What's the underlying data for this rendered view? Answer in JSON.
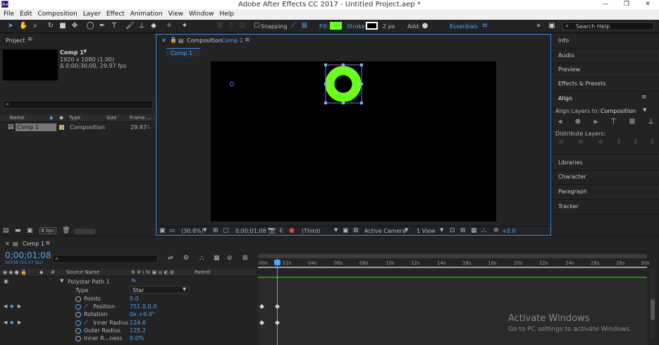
{
  "window": {
    "title": "Adobe After Effects CC 2017 - Untitled Project.aep *",
    "logo": "Ae"
  },
  "menu": [
    "File",
    "Edit",
    "Composition",
    "Layer",
    "Effect",
    "Animation",
    "View",
    "Window",
    "Help"
  ],
  "toolbar": {
    "snapping": "Snapping",
    "fill_label": "Fill:",
    "stroke_label": "Stroke:",
    "stroke_width": "2 px",
    "add_label": "Add:",
    "workspace": "Essentials",
    "search_placeholder": "Search Help",
    "fill_color": "#6bff1a"
  },
  "project": {
    "tab": "Project",
    "comp_name": "Comp 1",
    "comp_res": "1920 x 1080 (1.00)",
    "comp_dur": "Δ 0;00;30;00, 29.97 fps",
    "search_placeholder": "",
    "columns": [
      "Name",
      "Type",
      "Size",
      "Frame ..."
    ],
    "item": {
      "name": "Comp 1",
      "type": "Composition",
      "fps": "29.97"
    },
    "bpc": "8 bpc"
  },
  "composition": {
    "tab_prefix": "Composition",
    "tab_name": "Comp 1",
    "sub_tab": "Comp 1",
    "zoom": "(30.8%)",
    "timecode": "0;00;01;08",
    "resolution": "(Third)",
    "camera": "Active Camera",
    "views": "1 View",
    "exposure": "+0.0"
  },
  "right_panel": {
    "items_top": [
      "Info",
      "Audio",
      "Preview",
      "Effects & Presets"
    ],
    "align_title": "Align",
    "align_to_label": "Align Layers to:",
    "align_to_value": "Composition",
    "distribute_label": "Distribute Layers:",
    "items_bottom": [
      "Libraries",
      "Character",
      "Paragraph",
      "Tracker"
    ]
  },
  "timeline": {
    "tab": "Comp 1",
    "timecode": "0;00;01;08",
    "frame_info": "00038 (29.97 fps)",
    "columns": {
      "source": "Source Name",
      "parent": "Parent"
    },
    "ruler": [
      "00s",
      "02s",
      "04s",
      "06s",
      "08s",
      "10s",
      "12s",
      "14s",
      "16s",
      "18s",
      "20s",
      "22s",
      "24s",
      "26s",
      "28s",
      "30s"
    ],
    "rows": [
      {
        "name": "Polystar Path 1",
        "value": ""
      },
      {
        "name": "Type",
        "value": "Star"
      },
      {
        "name": "Points",
        "value": "5.0"
      },
      {
        "name": "Position",
        "value": "751.0,0.0"
      },
      {
        "name": "Rotation",
        "value": "0x +0.0°"
      },
      {
        "name": "Inner Radius",
        "value": "124.6"
      },
      {
        "name": "Outer Radius",
        "value": "125.2"
      },
      {
        "name": "Inner R...ness",
        "value": "0.0%"
      }
    ]
  },
  "activation": {
    "title": "Activate Windows",
    "subtitle": "Go to PC settings to activate Windows."
  }
}
